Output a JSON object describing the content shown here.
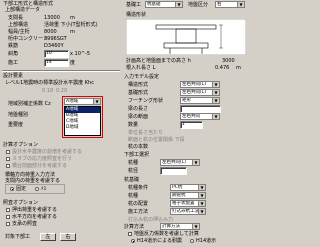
{
  "left": {
    "section_title": "下部工形式と構造形式",
    "sub_title": "上部構造データ",
    "rows": [
      {
        "label": "支間長",
        "value": "13000",
        "unit": "m"
      },
      {
        "label": "上部構造",
        "value": "活荷重 下小(T型桁形式)"
      },
      {
        "label": "幅員/主桁",
        "value": "8000",
        "unit": "m"
      },
      {
        "label": "桁中コンクリート",
        "value": "3996SGT"
      },
      {
        "label": "鉄筋",
        "value": "D3460Y"
      },
      {
        "label": "斜角",
        "value": "10",
        "unit": "x 10^-5"
      },
      {
        "label": "施工",
        "value": "14",
        "unit": "度"
      }
    ],
    "design_section": "設計要素",
    "seismic_label": "レベル1地震時の標準設計水平震度 Khc",
    "kh_label1": "0.18",
    "kh_label2": "0.20",
    "ground_label": "地域別補正係数 Cz",
    "ground_value": "A地域",
    "ground_options": [
      "A地域",
      "B地域",
      "C地域",
      "D地域"
    ],
    "ground_type_label": "地盤種別",
    "importance_label": "重要度",
    "calc_option_title": "計算オプション",
    "calc_option1": "設計水平震度の割増を考慮する",
    "calc_option2": "スラブの応力度照査を行う",
    "calc_option3": "橋台前面部分を考慮する",
    "span_option_label": "橋軸方向荷重入力方法",
    "span_option_radio1": "支間内の荷重を考慮する",
    "span_option_radio2": "他の上部構造の荷重を考慮",
    "option_radio_a": "固定",
    "option_radio_b": "ﾒｽ",
    "check_section": "照査オプション",
    "check_opt1": "押出荷重を考慮する",
    "check_opt2": "水平方向を考慮する",
    "check_opt3": "支承の照査",
    "footer_label": "対象下部工",
    "footer_col1": "左",
    "footer_col2": "右"
  },
  "right": {
    "combo1_label": "基礎工",
    "combo1_value": "杭基礎",
    "combo2_label": "地盤区分",
    "combo2_value": "右",
    "diagram_label": "構造形状",
    "height_label": "計画高と地盤面までの高さ h",
    "height_value": "3000",
    "depth_label": "根入れ長さ L",
    "depth_value": "0.476",
    "depth_unit": "m",
    "model_section": "入力モデル設定",
    "rows": [
      {
        "label": "構造形式",
        "value": "左右共同(L)"
      },
      {
        "label": "基礎形式",
        "value": "左右共同(L)"
      },
      {
        "label": "フーチング形状",
        "value": "矩形"
      },
      {
        "label": "梁の長さ",
        "value": ""
      },
      {
        "label": "梁の断面",
        "value": "左右共同"
      },
      {
        "label": "数量",
        "value": "1"
      }
    ],
    "note1": "単位長さ当たり",
    "note2": "断面と杭の位置関係 下段",
    "pile_count_label": "杭の本数",
    "pile_section": "下部工選択",
    "pile_type_label": "杭種",
    "pile_type_value": "左右共同(L)",
    "pile_dia_label": "杭径",
    "pile_dia_value": "",
    "foundation_section": "杭基礎",
    "f_rows": [
      {
        "label": "杭種条件",
        "value": "PC杭"
      },
      {
        "label": "杭種",
        "value": "鋼管杭"
      },
      {
        "label": "杭の配置",
        "value": "格子状配置"
      },
      {
        "label": "施工方法",
        "value": "打込み杭工法"
      }
    ],
    "f_note": "打込み杭の押込み力",
    "calc_section": "計算方法",
    "calc_value": "計算方法",
    "calc_opt1": "地盤反力係数を考慮して計算",
    "calc_opt2": "液状化",
    "calc_opt3": "H14道示による耐震",
    "calc_opt4": "H14道示"
  }
}
